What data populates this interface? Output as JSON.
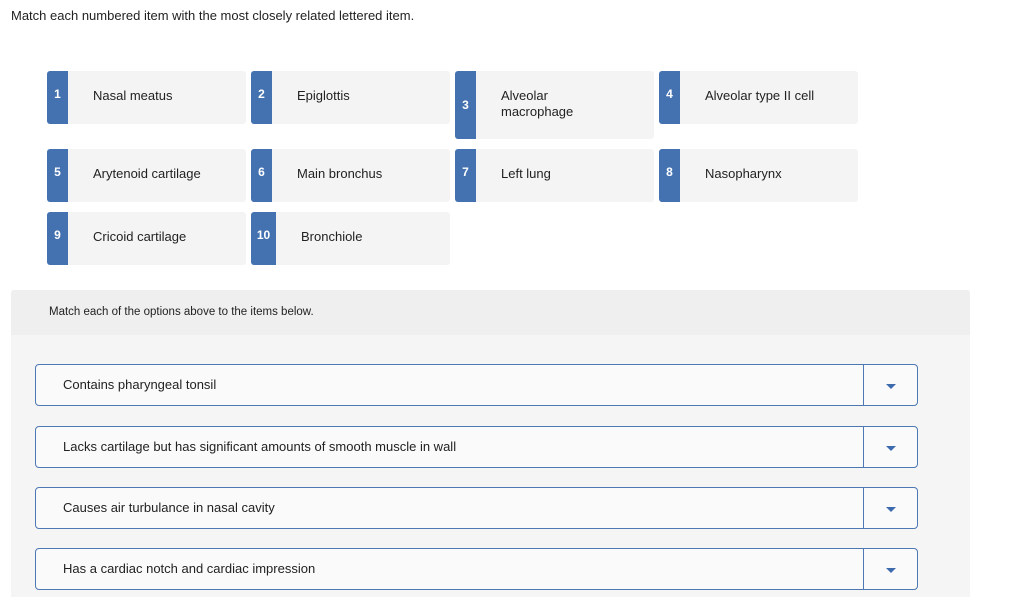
{
  "instruction": "Match each numbered item with the most closely related lettered item.",
  "items": [
    {
      "number": "1",
      "label": "Nasal meatus"
    },
    {
      "number": "2",
      "label": "Epiglottis"
    },
    {
      "number": "3",
      "label": "Alveolar macrophage"
    },
    {
      "number": "4",
      "label": "Alveolar type II cell"
    },
    {
      "number": "5",
      "label": "Arytenoid cartilage"
    },
    {
      "number": "6",
      "label": "Main bronchus"
    },
    {
      "number": "7",
      "label": "Left lung"
    },
    {
      "number": "8",
      "label": "Nasopharynx"
    },
    {
      "number": "9",
      "label": "Cricoid cartilage"
    },
    {
      "number": "10",
      "label": "Bronchiole"
    }
  ],
  "panel": {
    "header": "Match each of the options above to the items below.",
    "selects": [
      {
        "label": "Contains pharyngeal tonsil",
        "value": ""
      },
      {
        "label": "Lacks cartilage but has significant amounts of smooth muscle in wall",
        "value": ""
      },
      {
        "label": "Causes air turbulance in nasal cavity",
        "value": ""
      },
      {
        "label": "Has a cardiac notch and cardiac impression",
        "value": ""
      }
    ]
  },
  "colors": {
    "accent": "#4472b0",
    "card_bg": "#f4f4f4",
    "panel_bg": "#f5f5f5"
  }
}
